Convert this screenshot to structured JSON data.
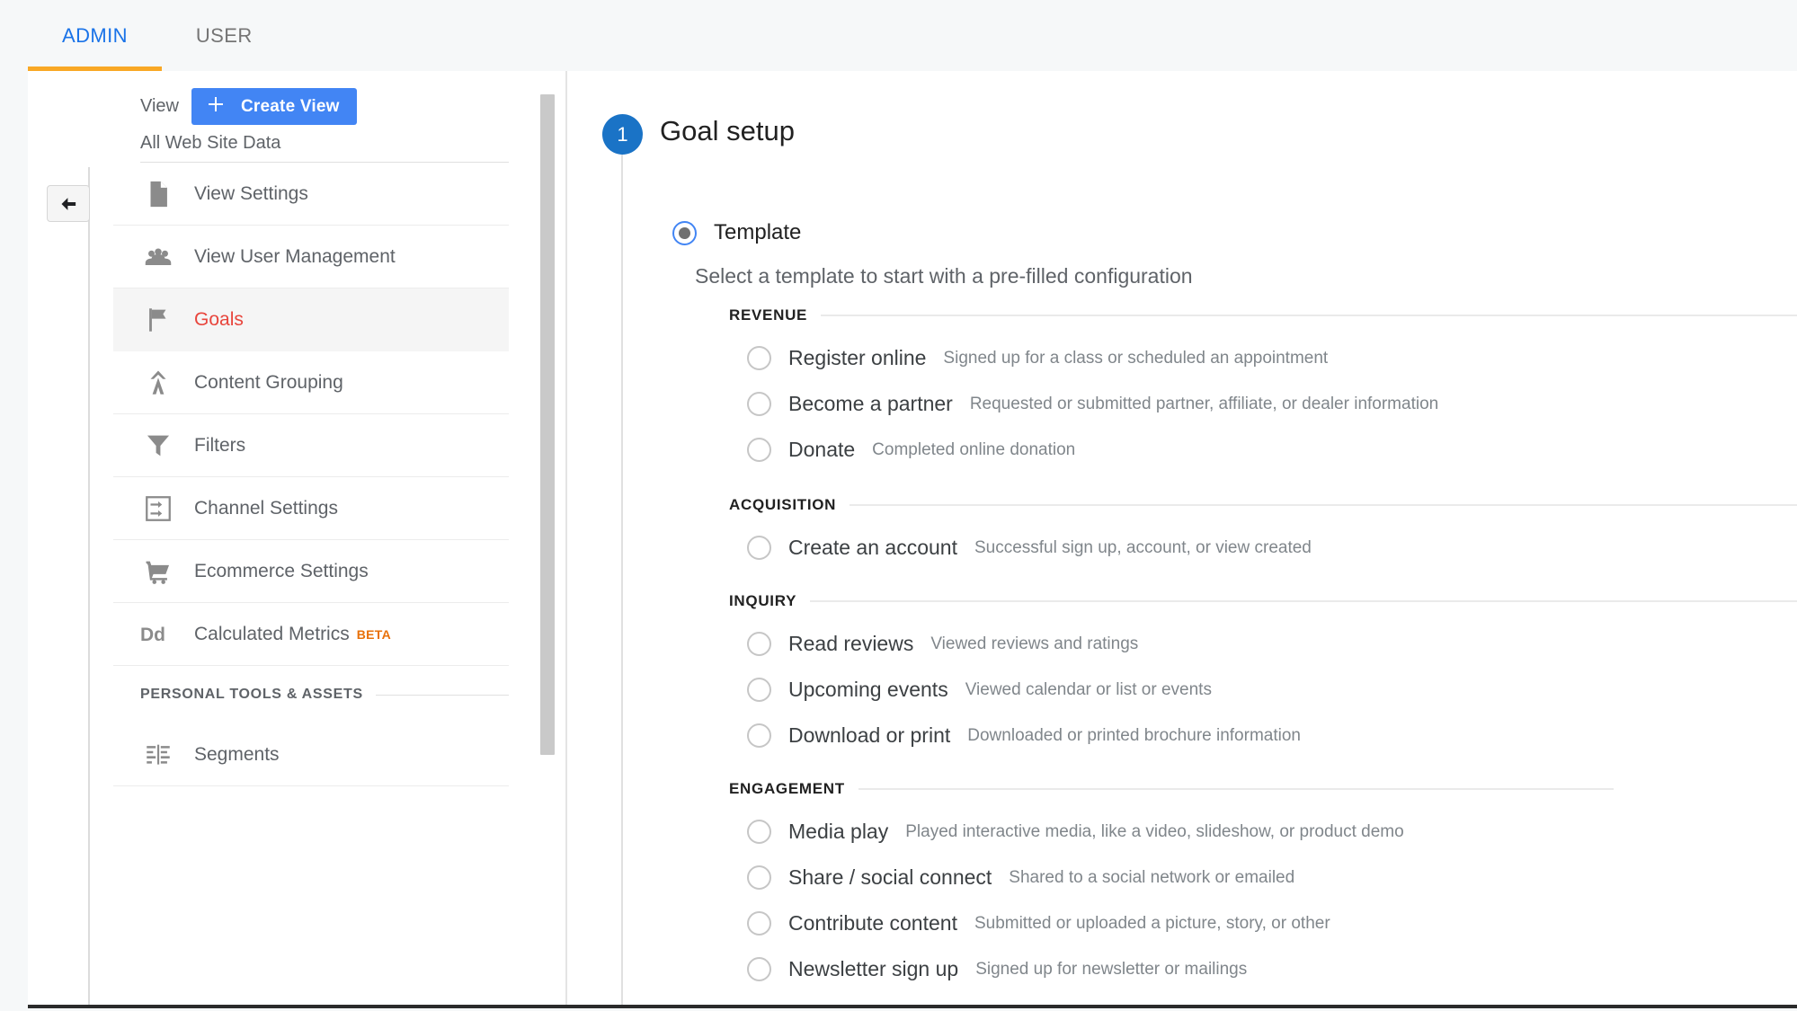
{
  "topbar": {
    "tabs": [
      {
        "label": "ADMIN",
        "active": true
      },
      {
        "label": "USER",
        "active": false
      }
    ]
  },
  "gutter": {
    "back_button_icon": "back-arrow-icon"
  },
  "sidebar": {
    "view_label": "View",
    "create_view_button": "Create View",
    "view_name": "All Web Site Data",
    "items": [
      {
        "label": "View Settings",
        "icon": "document-icon",
        "selected": false
      },
      {
        "label": "View User Management",
        "icon": "people-icon",
        "selected": false
      },
      {
        "label": "Goals",
        "icon": "flag-icon",
        "selected": true
      },
      {
        "label": "Content Grouping",
        "icon": "content-grouping-icon",
        "selected": false
      },
      {
        "label": "Filters",
        "icon": "funnel-icon",
        "selected": false
      },
      {
        "label": "Channel Settings",
        "icon": "channel-settings-icon",
        "selected": false
      },
      {
        "label": "Ecommerce Settings",
        "icon": "shopping-cart-icon",
        "selected": false
      },
      {
        "label": "Calculated Metrics",
        "icon": "dd-icon",
        "badge": "BETA",
        "selected": false
      }
    ],
    "section_title": "PERSONAL TOOLS & ASSETS",
    "section_items": [
      {
        "label": "Segments",
        "icon": "segments-icon",
        "selected": false
      }
    ]
  },
  "main": {
    "step_number": "1",
    "step_title": "Goal setup",
    "template_radio_label": "Template",
    "template_radio_checked": true,
    "subtitle": "Select a template to start with a pre-filled configuration",
    "groups": [
      {
        "title": "REVENUE",
        "options": [
          {
            "name": "Register online",
            "desc": "Signed up for a class or scheduled an appointment",
            "checked": false
          },
          {
            "name": "Become a partner",
            "desc": "Requested or submitted partner, affiliate, or dealer information",
            "checked": false
          },
          {
            "name": "Donate",
            "desc": "Completed online donation",
            "checked": false
          }
        ]
      },
      {
        "title": "ACQUISITION",
        "options": [
          {
            "name": "Create an account",
            "desc": "Successful sign up, account, or view created",
            "checked": false
          }
        ]
      },
      {
        "title": "INQUIRY",
        "options": [
          {
            "name": "Read reviews",
            "desc": "Viewed reviews and ratings",
            "checked": false
          },
          {
            "name": "Upcoming events",
            "desc": "Viewed calendar or list or events",
            "checked": false
          },
          {
            "name": "Download or print",
            "desc": "Downloaded or printed brochure information",
            "checked": false
          }
        ]
      },
      {
        "title": "ENGAGEMENT",
        "options": [
          {
            "name": "Media play",
            "desc": "Played interactive media, like a video, slideshow, or product demo",
            "checked": false
          },
          {
            "name": "Share / social connect",
            "desc": "Shared to a social network or emailed",
            "checked": false
          },
          {
            "name": "Contribute content",
            "desc": "Submitted or uploaded a picture, story, or other",
            "checked": false
          },
          {
            "name": "Newsletter sign up",
            "desc": "Signed up for newsletter or mailings",
            "checked": false
          }
        ]
      }
    ]
  },
  "colors": {
    "accent_blue": "#1a73e8",
    "tab_underline": "#f9a825",
    "button_blue": "#4285f4",
    "selected_red": "#e8453c",
    "beta_orange": "#e8710a",
    "step_badge": "#1a73c6"
  }
}
